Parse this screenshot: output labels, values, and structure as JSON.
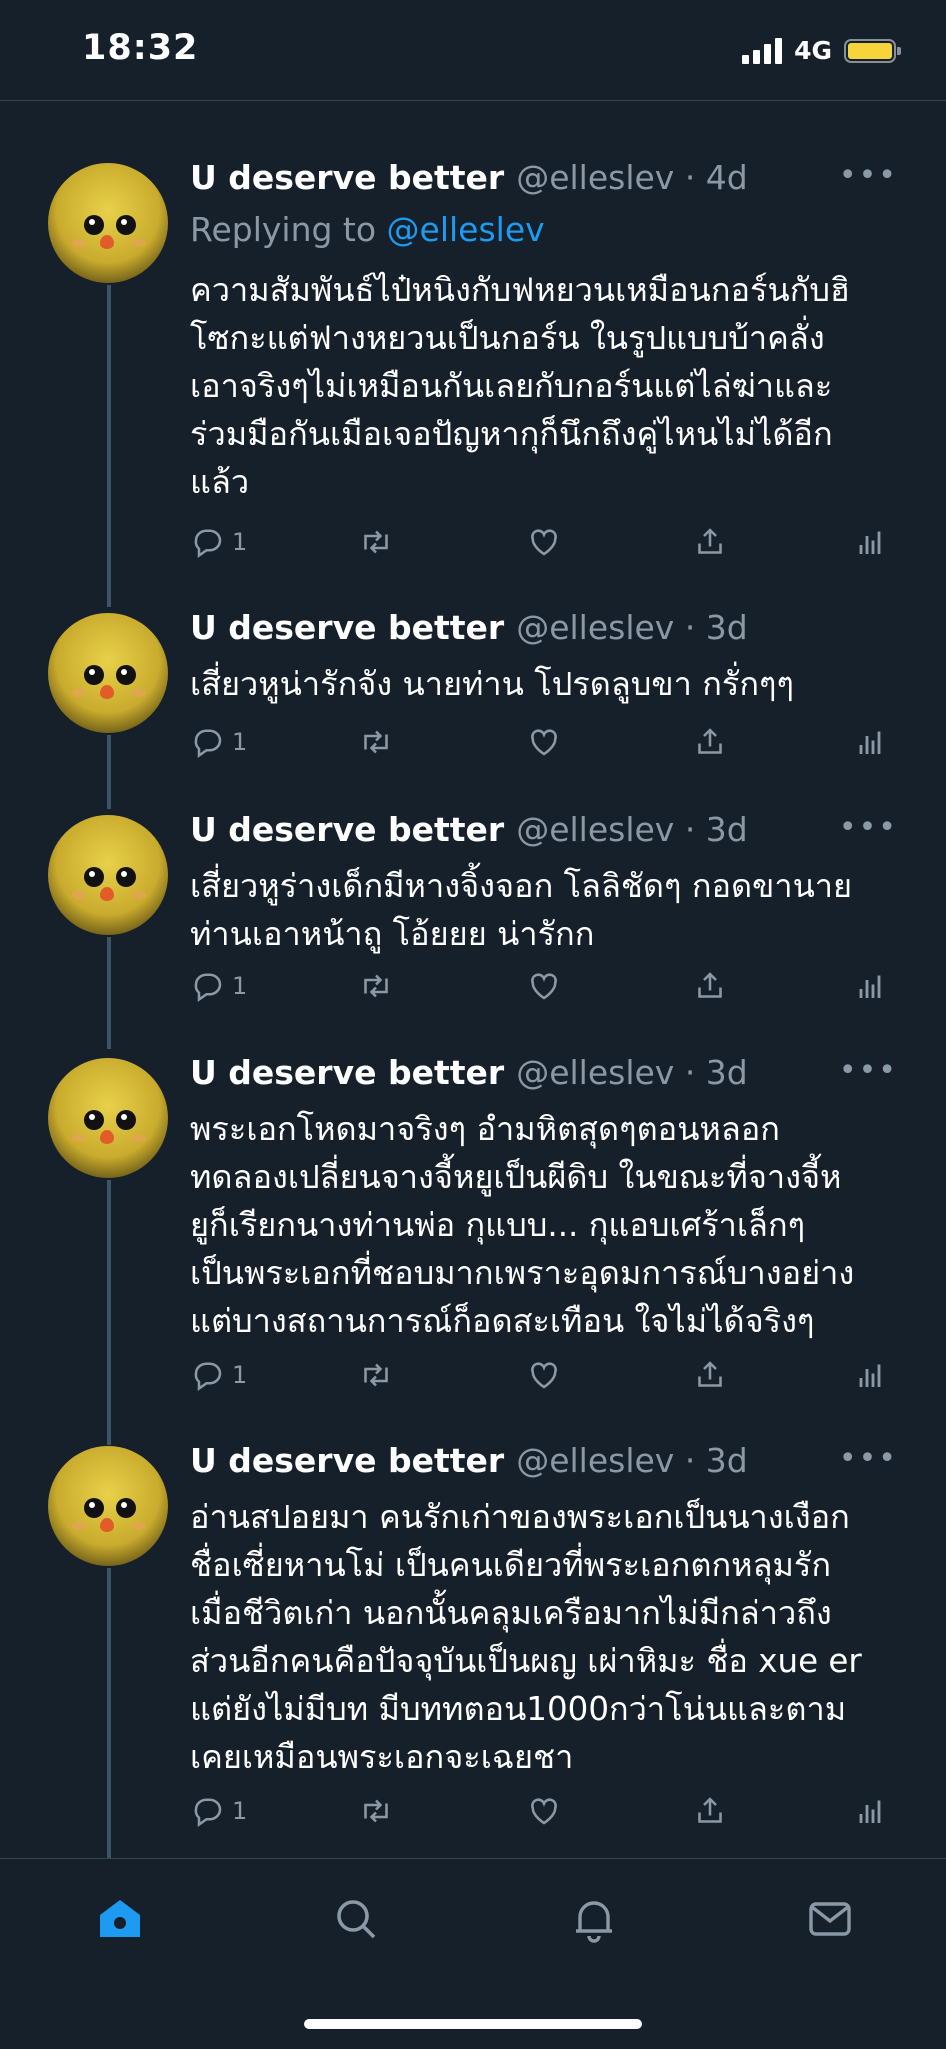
{
  "status_bar": {
    "time": "18:32",
    "network": "4G",
    "battery_color": "#f5d53b"
  },
  "colors": {
    "background": "#15202b",
    "accent": "#1d9bf0",
    "muted": "#8b98a5",
    "separator": "#38444d"
  },
  "tweets": [
    {
      "display_name": "U deserve better",
      "handle": "@elleslev · 4d",
      "replying_label": "Replying to",
      "replying_mention": "@elleslev",
      "text": "ความสัมพันธ์ไป๋หนิงกับฟหยวนเหมือนกอร์นกับฮิ\nโซกะแต่ฟางหยวนเป็นกอร์น ในรูปแบบบ้าคลั่ง\nเอาจริงๆไม่เหมือนกันเลยกับกอร์นแต่ไล่ฆ่าและ\nร่วมมือกันเมือเจอปัญหากุก็นึกถึงคู่ไหนไม่ได้อีก\nแล้ว",
      "reply_count": "1",
      "more": "•••"
    },
    {
      "display_name": "U deserve better",
      "handle": "@elleslev · 3d",
      "text": "เสี่ยวหูน่ารักจัง นายท่าน โปรดลูบขา กรั่กๆๆ",
      "reply_count": "1",
      "more": "•••"
    },
    {
      "display_name": "U deserve better",
      "handle": "@elleslev · 3d",
      "text": "เสี่ยวหูร่างเด็กมีหางจิ้งจอก โลลิชัดๆ กอดขานาย\nท่านเอาหน้าถู โอ้ยยย น่ารักก",
      "reply_count": "1",
      "more": "•••"
    },
    {
      "display_name": "U deserve better",
      "handle": "@elleslev · 3d",
      "text": "พระเอกโหดมาจริงๆ อำมหิตสุดๆตอนหลอก\nทดลองเปลี่ยนจางจี้หยูเป็นผีดิบ ในขณะที่จางจี้ห\nยูก็เรียกนางท่านพ่อ กุแบบ... กุแอบเศร้าเล็กๆ\nเป็นพระเอกที่ชอบมากเพราะอุดมการณ์บางอย่าง\nแต่บางสถานการณ์ก็อดสะเทือน ใจไม่ได้จริงๆ",
      "reply_count": "1",
      "more": "•••"
    },
    {
      "display_name": "U deserve better",
      "handle": "@elleslev · 3d",
      "text": "อ่านสปอยมา คนรักเก่าของพระเอกเป็นนางเงือก\nชื่อเซี่ยหานโม่ เป็นคนเดียวที่พระเอกตกหลุมรัก\nเมื่อชีวิตเก่า นอกนั้นคลุมเครือมากไม่มีกล่าวถึง\nส่วนอีกคนคือปัจจุบันเป็นผญ เผ่าหิมะ ชื่อ xue er\nแต่ยังไม่มีบท มีบททตอน1000กว่าโน่นและตาม\nเคยเหมือนพระเอกจะเฉยชา",
      "reply_count": "1",
      "more": "•••"
    }
  ],
  "tab_bar": {
    "items": [
      "home-icon",
      "search-icon",
      "notifications-icon",
      "messages-icon"
    ]
  }
}
